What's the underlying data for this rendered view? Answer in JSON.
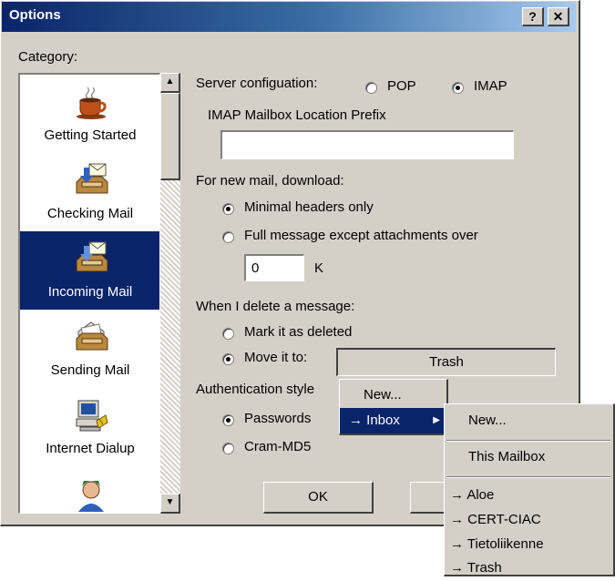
{
  "window": {
    "title": "Options",
    "help_btn": "?",
    "close_btn": "✕"
  },
  "category": {
    "label": "Category:",
    "items": [
      {
        "label": "Getting Started",
        "icon": "coffee-cup-icon",
        "selected": false
      },
      {
        "label": "Checking Mail",
        "icon": "inbox-download-icon",
        "selected": false
      },
      {
        "label": "Incoming Mail",
        "icon": "incoming-mail-icon",
        "selected": true
      },
      {
        "label": "Sending Mail",
        "icon": "outbox-icon",
        "selected": false
      },
      {
        "label": "Internet Dialup",
        "icon": "computer-dialup-icon",
        "selected": false
      }
    ]
  },
  "server": {
    "label": "Server configuation:",
    "options": [
      {
        "label": "POP",
        "checked": false
      },
      {
        "label": "IMAP",
        "checked": true
      }
    ],
    "prefix_label": "IMAP Mailbox Location Prefix",
    "prefix_value": ""
  },
  "download": {
    "label": "For new mail, download:",
    "options": [
      {
        "label": "Minimal headers only",
        "checked": true
      },
      {
        "label": "Full message except attachments over",
        "checked": false
      }
    ],
    "size_value": "0",
    "size_unit": "K"
  },
  "delete": {
    "label": "When I delete a message:",
    "options": [
      {
        "label": "Mark it as deleted",
        "checked": false
      },
      {
        "label": "Move it to:",
        "checked": true
      }
    ],
    "target_button": "Trash"
  },
  "auth": {
    "label": "Authentication style",
    "options": [
      {
        "label": "Passwords",
        "checked": true
      },
      {
        "label": "Cram-MD5",
        "checked": false
      }
    ]
  },
  "buttons": {
    "ok": "OK",
    "cancel": ""
  },
  "menu1": {
    "items": [
      "New...",
      "→ Inbox"
    ]
  },
  "menu2": {
    "items": [
      "New...",
      "This Mailbox"
    ],
    "mailboxes": [
      "→ Aloe",
      "→ CERT-CIAC",
      "→ Tietoliikenne",
      "→ Trash"
    ]
  }
}
